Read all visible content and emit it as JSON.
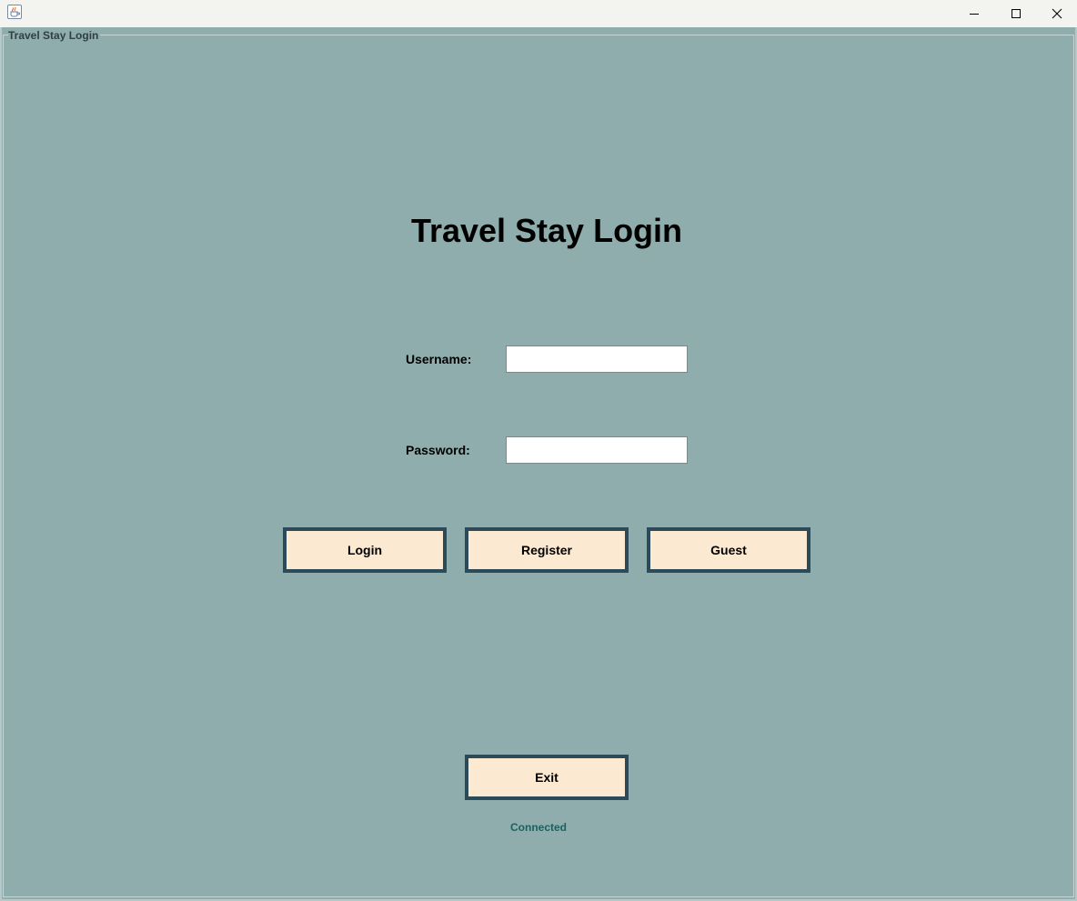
{
  "window": {
    "icon": "java-cup-icon",
    "controls": {
      "minimize": "minimize-icon",
      "maximize": "maximize-icon",
      "close": "close-icon"
    }
  },
  "panel": {
    "border_title": "Travel Stay Login"
  },
  "header": {
    "title": "Travel Stay Login"
  },
  "form": {
    "username_label": "Username:",
    "username_value": "",
    "password_label": "Password:",
    "password_value": ""
  },
  "actions": {
    "login_label": "Login",
    "register_label": "Register",
    "guest_label": "Guest",
    "exit_label": "Exit"
  },
  "status": {
    "text": "Connected"
  },
  "colors": {
    "background": "#8fadad",
    "button_fill": "#fbe9d1",
    "button_border": "#2c4a58",
    "status_text": "#1f5f5f"
  }
}
